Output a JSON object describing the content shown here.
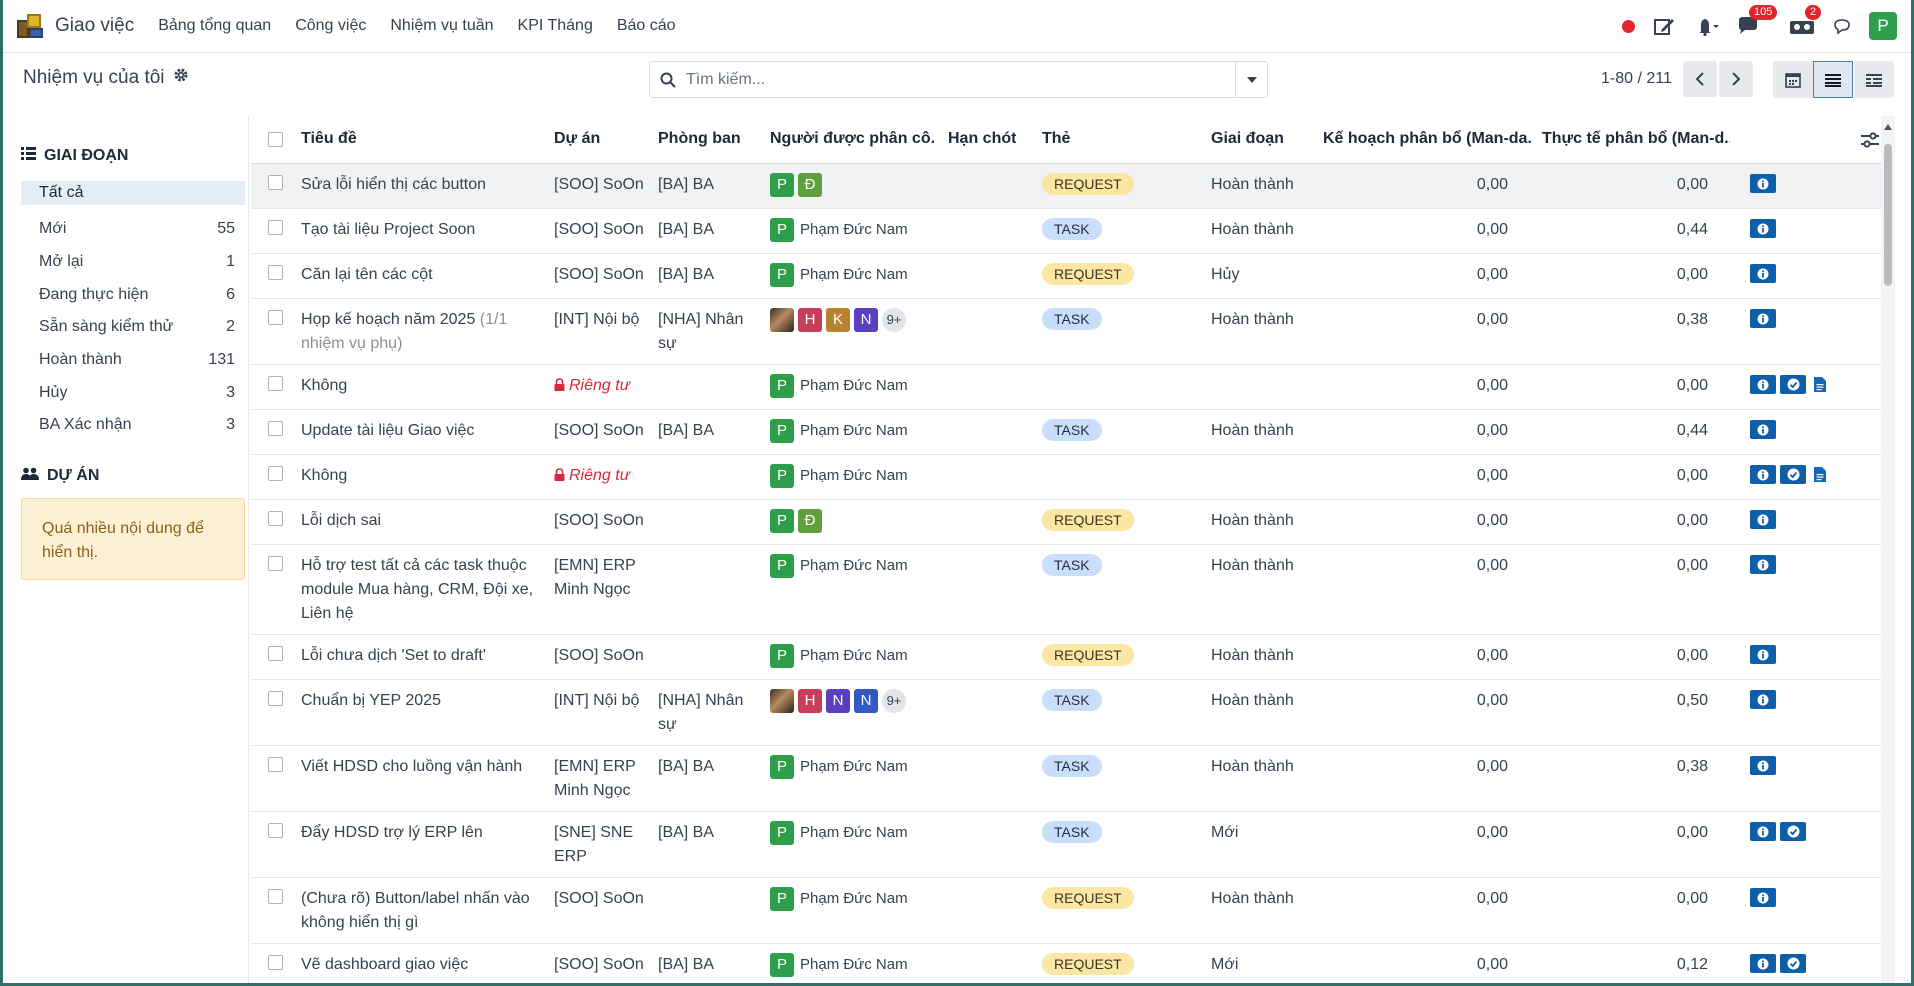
{
  "navbar": {
    "app_name": "Giao việc",
    "menu": [
      "Bảng tổng quan",
      "Công việc",
      "Nhiệm vụ tuần",
      "KPI Tháng",
      "Báo cáo"
    ],
    "messages_count": "105",
    "activities_count": "2",
    "user_initial": "P"
  },
  "control_panel": {
    "breadcrumb": "Nhiệm vụ của tôi",
    "search_placeholder": "Tìm kiếm...",
    "pager": "1-80 / 211"
  },
  "sidebar": {
    "stage_title": "GIAI ĐOẠN",
    "stages": [
      {
        "label": "Tất cả",
        "count": ""
      },
      {
        "label": "Mới",
        "count": "55"
      },
      {
        "label": "Mở lại",
        "count": "1"
      },
      {
        "label": "Đang thực hiện",
        "count": "6"
      },
      {
        "label": "Sẵn sàng kiểm thử",
        "count": "2"
      },
      {
        "label": "Hoàn thành",
        "count": "131"
      },
      {
        "label": "Hủy",
        "count": "3"
      },
      {
        "label": "BA Xác nhận",
        "count": "3"
      }
    ],
    "project_title": "DỰ ÁN",
    "project_warning": "Quá nhiều nội dung để hiển thị."
  },
  "table": {
    "columns": [
      "Tiêu đề",
      "Dự án",
      "Phòng ban",
      "Người được phân cô...",
      "Hạn chót",
      "Thẻ",
      "Giai đoạn",
      "Kế hoạch phân bổ (Man-da...",
      "Thực tế phân bổ (Man-d..."
    ],
    "rows": [
      {
        "title": "Sửa lỗi hiển thị các button",
        "project": "[SOO] SoOn",
        "dept": "[BA] BA",
        "assignees": [
          "P",
          "Đ"
        ],
        "tag": "REQUEST",
        "stage": "Hoàn thành",
        "plan": "0,00",
        "actual": "0,00"
      },
      {
        "title": "Tạo tài liệu Project Soon",
        "project": "[SOO] SoOn",
        "dept": "[BA] BA",
        "assignee_name": "Phạm Đức Nam",
        "tag": "TASK",
        "stage": "Hoàn thành",
        "plan": "0,00",
        "actual": "0,44"
      },
      {
        "title": "Căn lại tên các cột",
        "project": "[SOO] SoOn",
        "dept": "[BA] BA",
        "assignee_name": "Phạm Đức Nam",
        "tag": "REQUEST",
        "stage": "Hủy",
        "plan": "0,00",
        "actual": "0,00"
      },
      {
        "title": "Họp kế hoạch năm 2025",
        "subtasks": "(1/1 nhiệm vụ phụ)",
        "project": "[INT] Nội bộ",
        "dept": "[NHA] Nhân sự",
        "assignees": [
          "H",
          "K",
          "N"
        ],
        "more": "9+",
        "tag": "TASK",
        "stage": "Hoàn thành",
        "plan": "0,00",
        "actual": "0,38"
      },
      {
        "title": "Không",
        "private": "Riêng tư",
        "assignee_name": "Phạm Đức Nam",
        "plan": "0,00",
        "actual": "0,00"
      },
      {
        "title": "Update tài liệu Giao việc",
        "project": "[SOO] SoOn",
        "dept": "[BA] BA",
        "assignee_name": "Phạm Đức Nam",
        "tag": "TASK",
        "stage": "Hoàn thành",
        "plan": "0,00",
        "actual": "0,44"
      },
      {
        "title": "Không",
        "private": "Riêng tư",
        "assignee_name": "Phạm Đức Nam",
        "plan": "0,00",
        "actual": "0,00"
      },
      {
        "title": "Lỗi dịch sai",
        "project": "[SOO] SoOn",
        "assignees": [
          "P",
          "Đ"
        ],
        "tag": "REQUEST",
        "stage": "Hoàn thành",
        "plan": "0,00",
        "actual": "0,00"
      },
      {
        "title": "Hỗ trợ test tất cả các task thuộc module Mua hàng, CRM, Đội xe, Liên hệ",
        "project": "[EMN] ERP Minh Ngọc",
        "assignee_name": "Phạm Đức Nam",
        "tag": "TASK",
        "stage": "Hoàn thành",
        "plan": "0,00",
        "actual": "0,00"
      },
      {
        "title": "Lỗi chưa dịch 'Set to draft'",
        "project": "[SOO] SoOn",
        "assignee_name": "Phạm Đức Nam",
        "tag": "REQUEST",
        "stage": "Hoàn thành",
        "plan": "0,00",
        "actual": "0,00"
      },
      {
        "title": "Chuẩn bị YEP 2025",
        "project": "[INT] Nội bộ",
        "dept": "[NHA] Nhân sự",
        "assignees": [
          "H",
          "N",
          "N"
        ],
        "more": "9+",
        "tag": "TASK",
        "stage": "Hoàn thành",
        "plan": "0,00",
        "actual": "0,50"
      },
      {
        "title": "Viết HDSD cho luồng vận hành",
        "project": "[EMN] ERP Minh Ngọc",
        "dept": "[BA] BA",
        "assignee_name": "Phạm Đức Nam",
        "tag": "TASK",
        "stage": "Hoàn thành",
        "plan": "0,00",
        "actual": "0,38"
      },
      {
        "title": "Đẩy HDSD trợ lý ERP lên",
        "project": "[SNE] SNE ERP",
        "dept": "[BA] BA",
        "assignee_name": "Phạm Đức Nam",
        "tag": "TASK",
        "stage": "Mới",
        "plan": "0,00",
        "actual": "0,00"
      },
      {
        "title": "(Chưa rõ) Button/label nhấn vào không hiển thị gì",
        "project": "[SOO] SoOn",
        "assignee_name": "Phạm Đức Nam",
        "tag": "REQUEST",
        "stage": "Hoàn thành",
        "plan": "0,00",
        "actual": "0,00"
      },
      {
        "title": "Vẽ dashboard giao việc",
        "project": "[SOO] SoOn",
        "dept": "[BA] BA",
        "assignee_name": "Phạm Đức Nam",
        "tag": "REQUEST",
        "stage": "Mới",
        "plan": "0,00",
        "actual": "0,12"
      }
    ]
  }
}
